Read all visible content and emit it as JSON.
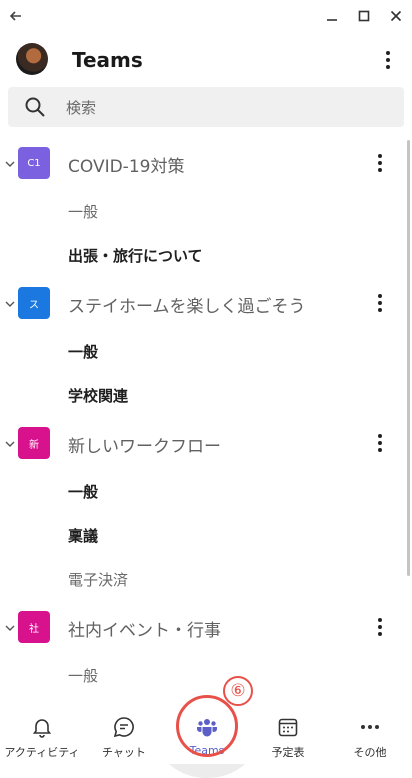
{
  "window": {
    "back_icon": "arrow-left-icon",
    "minimize_icon": "minimize-icon",
    "maximize_icon": "maximize-icon",
    "close_icon": "close-icon"
  },
  "header": {
    "title": "Teams"
  },
  "search": {
    "placeholder": "検索"
  },
  "teams": [
    {
      "tile_text": "C1",
      "tile_color": "#7b61e0",
      "name": "COVID-19対策",
      "channels": [
        {
          "label": "一般",
          "bold": false
        },
        {
          "label": "出張・旅行について",
          "bold": true
        }
      ]
    },
    {
      "tile_text": "ス",
      "tile_color": "#1a78e0",
      "name": "ステイホームを楽しく過ごそう",
      "channels": [
        {
          "label": "一般",
          "bold": true
        },
        {
          "label": "学校関連",
          "bold": true
        }
      ]
    },
    {
      "tile_text": "新",
      "tile_color": "#d8128c",
      "name": "新しいワークフロー",
      "channels": [
        {
          "label": "一般",
          "bold": true
        },
        {
          "label": "稟議",
          "bold": true
        },
        {
          "label": "電子決済",
          "bold": false
        }
      ]
    },
    {
      "tile_text": "社",
      "tile_color": "#d8128c",
      "name": "社内イベント・行事",
      "channels": [
        {
          "label": "一般",
          "bold": false
        }
      ]
    }
  ],
  "bottom_nav": [
    {
      "label": "アクティビティ",
      "icon": "bell-icon"
    },
    {
      "label": "チャット",
      "icon": "chat-icon"
    },
    {
      "label": "Teams",
      "icon": "teams-icon"
    },
    {
      "label": "予定表",
      "icon": "calendar-icon"
    },
    {
      "label": "その他",
      "icon": "more-horizontal-icon"
    }
  ],
  "annotation": {
    "step_number": "⑥",
    "highlight_color": "#e8514a"
  }
}
